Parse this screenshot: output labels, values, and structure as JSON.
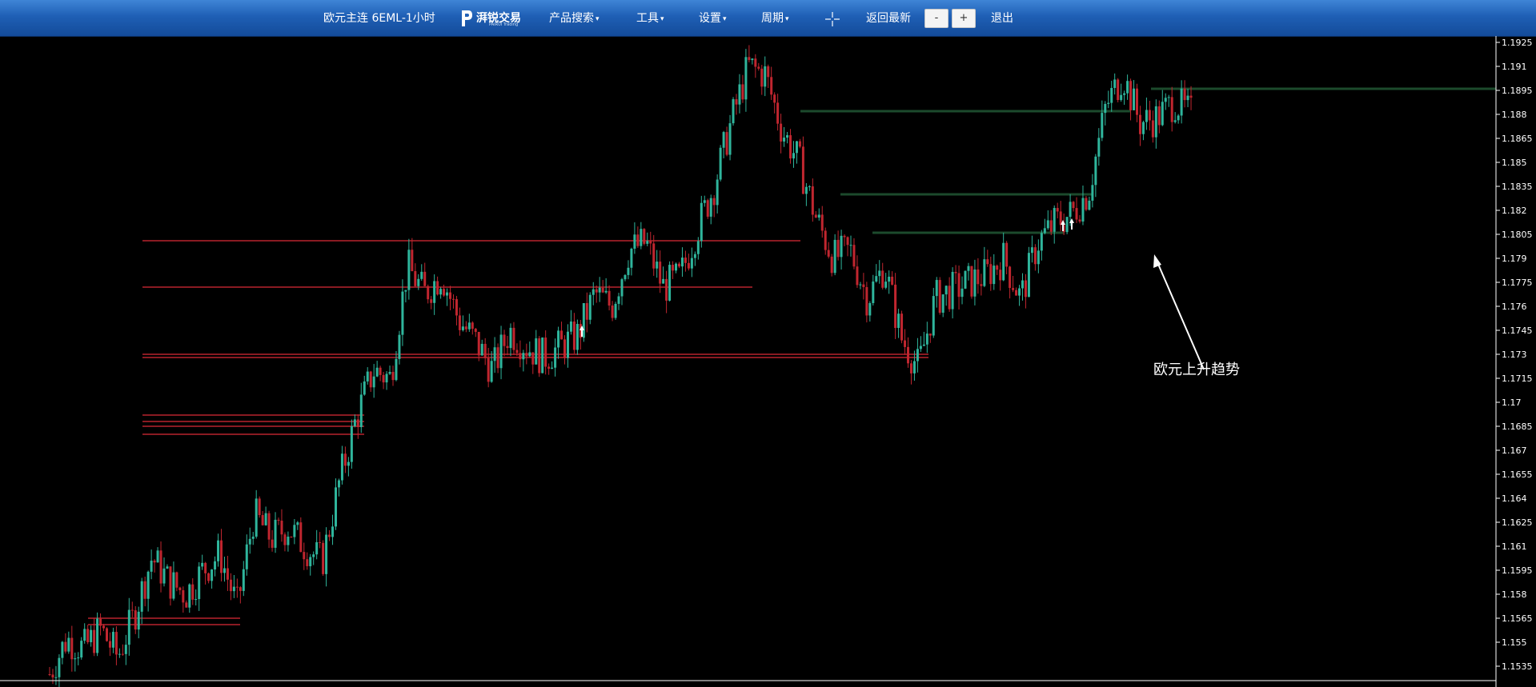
{
  "toolbar": {
    "symbol_title": "欧元主连 6EML-1小时",
    "logo_text": "湃锐交易",
    "logo_subtitle": "PAIRUI Trading",
    "menu_product_search": "产品搜索",
    "menu_tools": "工具",
    "menu_settings": "设置",
    "menu_period": "周期",
    "back_to_latest": "返回最新",
    "zoom_out": "-",
    "zoom_in": "+",
    "logout": "退出"
  },
  "annotation": {
    "text": "欧元上升趋势"
  },
  "colors": {
    "up": "#2fb59c",
    "down": "#c0262f",
    "background": "#000000",
    "toolbar": "#1f5fb5"
  },
  "chart_data": {
    "type": "candlestick",
    "title": "欧元主连 6EML-1小时",
    "ylim": [
      1.1525,
      1.1928
    ],
    "y_ticks": [
      "1.1925",
      "1.191",
      "1.1895",
      "1.188",
      "1.1865",
      "1.185",
      "1.1835",
      "1.182",
      "1.1805",
      "1.179",
      "1.1775",
      "1.176",
      "1.1745",
      "1.173",
      "1.1715",
      "1.17",
      "1.1685",
      "1.167",
      "1.1655",
      "1.164",
      "1.1625",
      "1.161",
      "1.1595",
      "1.158",
      "1.1565",
      "1.155",
      "1.1535"
    ],
    "close_path": [
      1.153,
      1.1552,
      1.1546,
      1.1558,
      1.1541,
      1.1568,
      1.1603,
      1.1588,
      1.158,
      1.1595,
      1.1605,
      1.1572,
      1.163,
      1.1615,
      1.1622,
      1.161,
      1.16,
      1.165,
      1.169,
      1.172,
      1.1715,
      1.1785,
      1.1768,
      1.178,
      1.1752,
      1.1738,
      1.172,
      1.1745,
      1.1735,
      1.1728,
      1.1735,
      1.1742,
      1.1768,
      1.176,
      1.1795,
      1.18,
      1.1772,
      1.1778,
      1.1808,
      1.1835,
      1.1875,
      1.191,
      1.1905,
      1.187,
      1.185,
      1.1815,
      1.179,
      1.1795,
      1.1765,
      1.1785,
      1.174,
      1.1722,
      1.1765,
      1.177,
      1.1775,
      1.178,
      1.179,
      1.1765,
      1.18,
      1.1812,
      1.1818,
      1.1832,
      1.1885,
      1.1905,
      1.1875,
      1.1878,
      1.1888,
      1.188
    ],
    "up_arrow_markers": [
      1.1747,
      1.1813,
      1.1814
    ],
    "horizontal_levels_red": [
      1.1801,
      1.1772,
      1.173,
      1.1728,
      1.1692,
      1.1688,
      1.1685,
      1.168,
      1.1565,
      1.1561
    ],
    "horizontal_levels_green": [
      1.1896,
      1.1882,
      1.183,
      1.1806
    ]
  }
}
